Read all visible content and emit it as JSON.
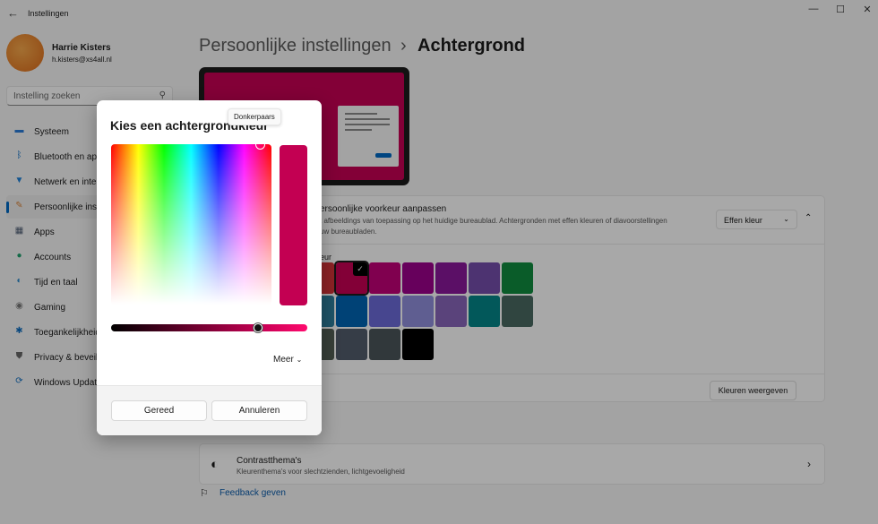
{
  "window": {
    "title": "Instellingen",
    "controls": [
      "—",
      "☐",
      "✕"
    ]
  },
  "user": {
    "name": "Harrie Kisters",
    "email": "h.kisters@xs4all.nl"
  },
  "search": {
    "placeholder": "Instelling zoeken"
  },
  "sidebar": {
    "items": [
      {
        "label": "Systeem",
        "icon": "monitor-icon",
        "glyph": "▬",
        "color": "#2b7bd5"
      },
      {
        "label": "Bluetooth en ap",
        "icon": "bluetooth-icon",
        "glyph": "ᛒ",
        "color": "#0067c0"
      },
      {
        "label": "Netwerk en inte",
        "icon": "wifi-icon",
        "glyph": "▼",
        "color": "#1d7fd6"
      },
      {
        "label": "Persoonlijke inst",
        "icon": "brush-icon",
        "glyph": "✎",
        "color": "#d8843c",
        "selected": true
      },
      {
        "label": "Apps",
        "icon": "apps-icon",
        "glyph": "▦",
        "color": "#4c5b72"
      },
      {
        "label": "Accounts",
        "icon": "person-icon",
        "glyph": "●",
        "color": "#1f9e6c"
      },
      {
        "label": "Tijd en taal",
        "icon": "globe-clock-icon",
        "glyph": "◐",
        "color": "#2a86c8"
      },
      {
        "label": "Gaming",
        "icon": "gamepad-icon",
        "glyph": "◉",
        "color": "#777"
      },
      {
        "label": "Toegankelijkheid",
        "icon": "accessibility-icon",
        "glyph": "✱",
        "color": "#0f6cbd"
      },
      {
        "label": "Privacy & beveil",
        "icon": "shield-icon",
        "glyph": "⛊",
        "color": "#666"
      },
      {
        "label": "Windows Updat",
        "icon": "update-icon",
        "glyph": "⟳",
        "color": "#0f6cbd"
      }
    ]
  },
  "breadcrumb": {
    "parent": "Persoonlijke instellingen",
    "separator": "›",
    "current": "Achtergrond"
  },
  "accent": "#c30052",
  "background_card": {
    "title": "Uw achtergrond aan uw persoonlijke voorkeur aanpassen",
    "title_visible": "ersoonlijke voorkeur aanpassen",
    "description_visible": "t afbeeldings van toepassing op het huidige bureaublad. Achtergronden met effen kleuren of diavoorstellingen",
    "description_visible_2": "uw bureaubladen.",
    "dropdown_value": "Effen kleur",
    "colors_label_visible": "eur",
    "swatches": [
      [
        "#d13438",
        "#c30052",
        "#bf0077",
        "#9a0089",
        "#881798",
        "#744da9",
        "#10893e"
      ],
      [
        "#2d7d9a",
        "#0063b1",
        "#6b69d6",
        "#8e8cd8",
        "#8764b8",
        "#038387",
        "#486860"
      ],
      [
        "#525e54",
        "#515c6b",
        "#4a5459",
        "#000000"
      ]
    ],
    "selected_swatch": "#c30052",
    "custom_button": "Kleuren weergeven"
  },
  "contrast": {
    "title": "Contrastthema's",
    "subtitle": "Kleurenthema's voor slechtzienden, lichtgevoeligheid"
  },
  "feedback": "Feedback geven",
  "dialog": {
    "title": "Kies een achtergrondkleur",
    "tooltip": "Donkerpaars",
    "selected_color": "#c30052",
    "brightness_percent": 75,
    "more": "Meer",
    "ok": "Gereed",
    "cancel": "Annuleren"
  }
}
